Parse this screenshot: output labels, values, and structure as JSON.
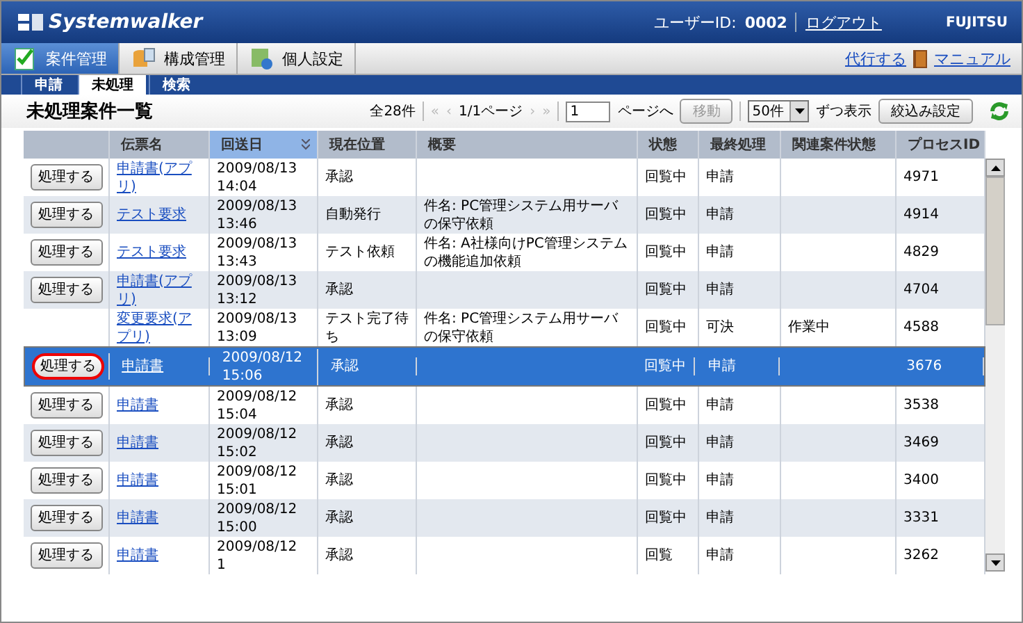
{
  "header": {
    "logo": "Systemwalker",
    "user_label": "ユーザーID:",
    "user_id": "0002",
    "logout": "ログアウト",
    "brand": "FUJITSU"
  },
  "nav_tabs": [
    {
      "label": "案件管理",
      "selected": true
    },
    {
      "label": "構成管理",
      "selected": false
    },
    {
      "label": "個人設定",
      "selected": false
    }
  ],
  "nav_links": [
    "代行する",
    "マニュアル"
  ],
  "sub_tabs": [
    {
      "label": "申請",
      "selected": false
    },
    {
      "label": "未処理",
      "selected": true
    },
    {
      "label": "検索",
      "selected": false
    }
  ],
  "toolbar": {
    "title": "未処理案件一覧",
    "total": "全28件",
    "first": "«",
    "prev": "‹",
    "page": "1/1ページ",
    "next": "›",
    "last": "»",
    "page_input": "1",
    "page_suffix": "ページへ",
    "go_button": {
      "label": "移動",
      "disabled": true
    },
    "per_page": "50件",
    "per_page_suffix": "ずつ表示",
    "filter_button": "絞込み設定"
  },
  "table": {
    "columns": [
      {
        "label": "伝票名",
        "sorted": false
      },
      {
        "label": "回送日",
        "sorted": true
      },
      {
        "label": "現在位置",
        "sorted": false
      },
      {
        "label": "概要",
        "sorted": false
      },
      {
        "label": "状態",
        "sorted": false
      },
      {
        "label": "最終処理",
        "sorted": false
      },
      {
        "label": "関連案件状態",
        "sorted": false
      },
      {
        "label": "プロセスID",
        "sorted": false
      }
    ],
    "rows": [
      {
        "action": "処理する",
        "circled": false,
        "selected": false,
        "form": "申請書(アプリ)",
        "date": "2009/08/13 14:04",
        "location": "承認",
        "summary": "",
        "status": "回覧中",
        "last": "申請",
        "related": "",
        "pid": "4971"
      },
      {
        "action": "処理する",
        "circled": false,
        "selected": false,
        "form": "テスト要求",
        "date": "2009/08/13 13:46",
        "location": "自動発行",
        "summary": "件名: PC管理システム用サーバの保守依頼",
        "status": "回覧中",
        "last": "申請",
        "related": "",
        "pid": "4914"
      },
      {
        "action": "処理する",
        "circled": false,
        "selected": false,
        "form": "テスト要求",
        "date": "2009/08/13 13:43",
        "location": "テスト依頼",
        "summary": "件名: A社様向けPC管理システムの機能追加依頼",
        "status": "回覧中",
        "last": "申請",
        "related": "",
        "pid": "4829"
      },
      {
        "action": "処理する",
        "circled": false,
        "selected": false,
        "form": "申請書(アプリ)",
        "date": "2009/08/13 13:12",
        "location": "承認",
        "summary": "",
        "status": "回覧中",
        "last": "申請",
        "related": "",
        "pid": "4704"
      },
      {
        "selected": false,
        "form": "変更要求(アプリ)",
        "date": "2009/08/13 13:09",
        "location": "テスト完了待ち",
        "summary": "件名: PC管理システム用サーバの保守依頼",
        "status": "回覧中",
        "last": "可決",
        "related": "作業中",
        "pid": "4588"
      },
      {
        "action": "処理する",
        "circled": true,
        "selected": true,
        "form": "申請書",
        "date": "2009/08/12 15:06",
        "location": "承認",
        "summary": "",
        "status": "回覧中",
        "last": "申請",
        "related": "",
        "pid": "3676"
      },
      {
        "action": "処理する",
        "circled": false,
        "selected": false,
        "form": "申請書",
        "date": "2009/08/12 15:04",
        "location": "承認",
        "summary": "",
        "status": "回覧中",
        "last": "申請",
        "related": "",
        "pid": "3538"
      },
      {
        "action": "処理する",
        "circled": false,
        "selected": false,
        "form": "申請書",
        "date": "2009/08/12 15:02",
        "location": "承認",
        "summary": "",
        "status": "回覧中",
        "last": "申請",
        "related": "",
        "pid": "3469"
      },
      {
        "action": "処理する",
        "circled": false,
        "selected": false,
        "form": "申請書",
        "date": "2009/08/12 15:01",
        "location": "承認",
        "summary": "",
        "status": "回覧中",
        "last": "申請",
        "related": "",
        "pid": "3400"
      },
      {
        "action": "処理する",
        "circled": false,
        "selected": false,
        "form": "申請書",
        "date": "2009/08/12 15:00",
        "location": "承認",
        "summary": "",
        "status": "回覧中",
        "last": "申請",
        "related": "",
        "pid": "3331"
      },
      {
        "action": "処理する",
        "circled": false,
        "selected": false,
        "form": "申請書",
        "date": "2009/08/12 1",
        "location": "承認",
        "summary": "",
        "status": "回覧",
        "last": "申請",
        "related": "",
        "pid": "3262"
      }
    ]
  }
}
